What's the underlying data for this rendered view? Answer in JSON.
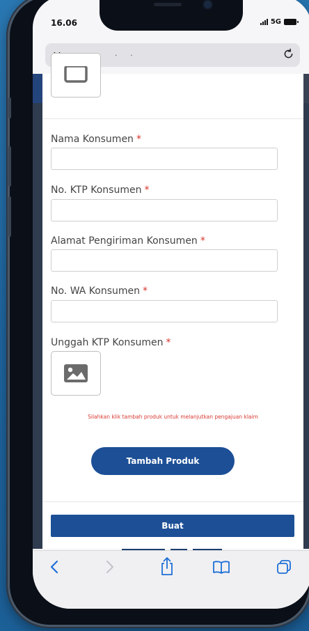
{
  "status_bar": {
    "time": "16.06",
    "network": "5G"
  },
  "browser": {
    "aa_label": "AA",
    "url_text": ". .",
    "reload_icon": "reload-icon"
  },
  "form": {
    "fields": [
      {
        "label": "Nama Konsumen",
        "required": "*",
        "value": ""
      },
      {
        "label": "No. KTP Konsumen",
        "required": "*",
        "value": ""
      },
      {
        "label": "Alamat Pengiriman Konsumen",
        "required": "*",
        "value": ""
      },
      {
        "label": "No. WA Konsumen",
        "required": "*",
        "value": ""
      }
    ],
    "upload": {
      "label": "Unggah KTP Konsumen",
      "required": "*",
      "icon": "image-icon"
    },
    "warning": "Silahkan klik tambah produk untuk melanjutkan pengajuan klaim",
    "add_product_label": "Tambah Produk",
    "submit_label": "Buat"
  },
  "toolbar": {
    "icons": [
      "back-icon",
      "forward-icon",
      "share-icon",
      "bookmarks-icon",
      "tabs-icon"
    ]
  },
  "colors": {
    "primary": "#1c4f96",
    "required": "#d9342b",
    "background": "#1f67a2"
  }
}
